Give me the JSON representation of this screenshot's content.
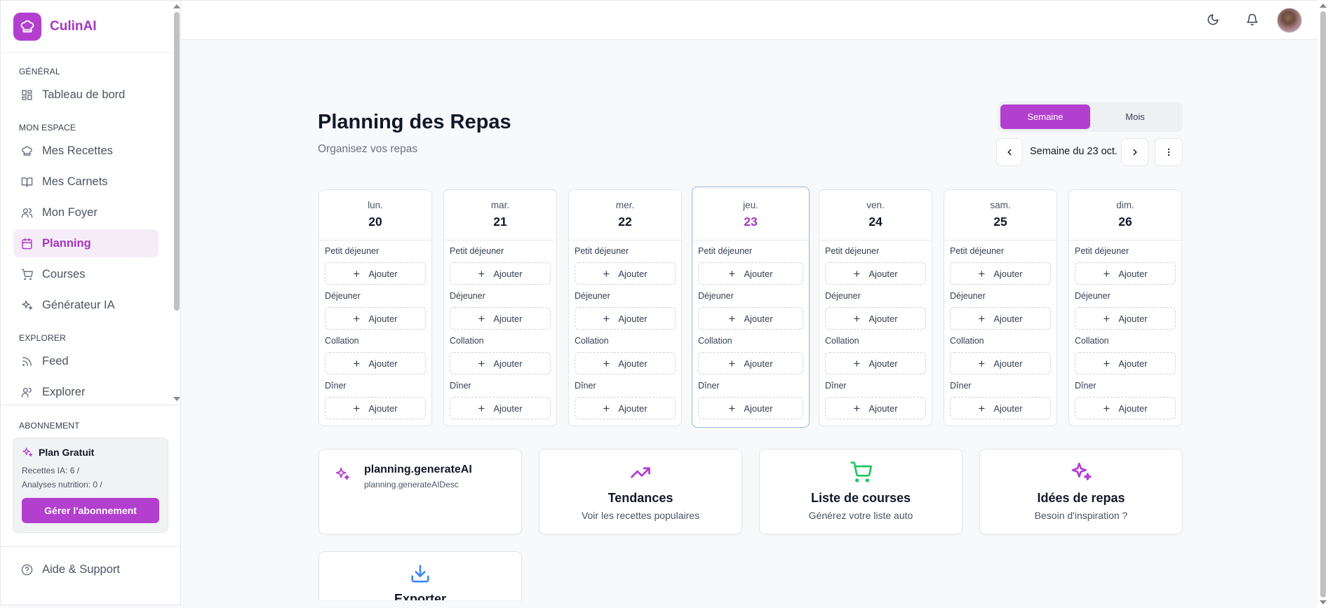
{
  "brand": {
    "name": "CulinAI"
  },
  "sidebar": {
    "sections": [
      {
        "title": "GÉNÉRAL",
        "items": [
          {
            "label": "Tableau de bord",
            "icon": "dashboard-icon"
          }
        ]
      },
      {
        "title": "MON ESPACE",
        "items": [
          {
            "label": "Mes Recettes",
            "icon": "chef-hat-icon"
          },
          {
            "label": "Mes Carnets",
            "icon": "book-icon"
          },
          {
            "label": "Mon Foyer",
            "icon": "users-icon"
          },
          {
            "label": "Planning",
            "icon": "calendar-icon",
            "active": true
          },
          {
            "label": "Courses",
            "icon": "cart-icon"
          },
          {
            "label": "Générateur IA",
            "icon": "sparkles-icon"
          }
        ]
      },
      {
        "title": "EXPLORER",
        "items": [
          {
            "label": "Feed",
            "icon": "rss-icon"
          },
          {
            "label": "Explorer",
            "icon": "users-icon"
          }
        ]
      }
    ],
    "subscription": {
      "title": "ABONNEMENT",
      "plan": "Plan Gratuit",
      "ai_recipes": "Recettes IA: 6 /",
      "nutrition": "Analyses nutrition: 0 /",
      "button": "Gérer l'abonnement"
    },
    "help": "Aide & Support"
  },
  "header": {
    "title": "Planning des Repas",
    "subtitle": "Organisez vos repas"
  },
  "view_toggle": {
    "week": "Semaine",
    "month": "Mois",
    "selected": "Semaine"
  },
  "week_nav": {
    "label": "Semaine du 23 oct."
  },
  "days": [
    {
      "name": "lun.",
      "num": "20"
    },
    {
      "name": "mar.",
      "num": "21"
    },
    {
      "name": "mer.",
      "num": "22"
    },
    {
      "name": "jeu.",
      "num": "23",
      "today": true
    },
    {
      "name": "ven.",
      "num": "24"
    },
    {
      "name": "sam.",
      "num": "25"
    },
    {
      "name": "dim.",
      "num": "26"
    }
  ],
  "meals": [
    "Petit déjeuner",
    "Déjeuner",
    "Collation",
    "Dîner"
  ],
  "add_label": "Ajouter",
  "cards": {
    "ai": {
      "title": "planning.generateAI",
      "desc": "planning.generateAIDesc"
    },
    "trends": {
      "title": "Tendances",
      "desc": "Voir les recettes populaires"
    },
    "shopping": {
      "title": "Liste de courses",
      "desc": "Générez votre liste auto"
    },
    "ideas": {
      "title": "Idées de repas",
      "desc": "Besoin d'inspiration ?"
    },
    "export": {
      "title": "Exporter"
    }
  },
  "colors": {
    "accent": "#b33fcf",
    "green": "#22c55e",
    "blue": "#3b82f6"
  }
}
